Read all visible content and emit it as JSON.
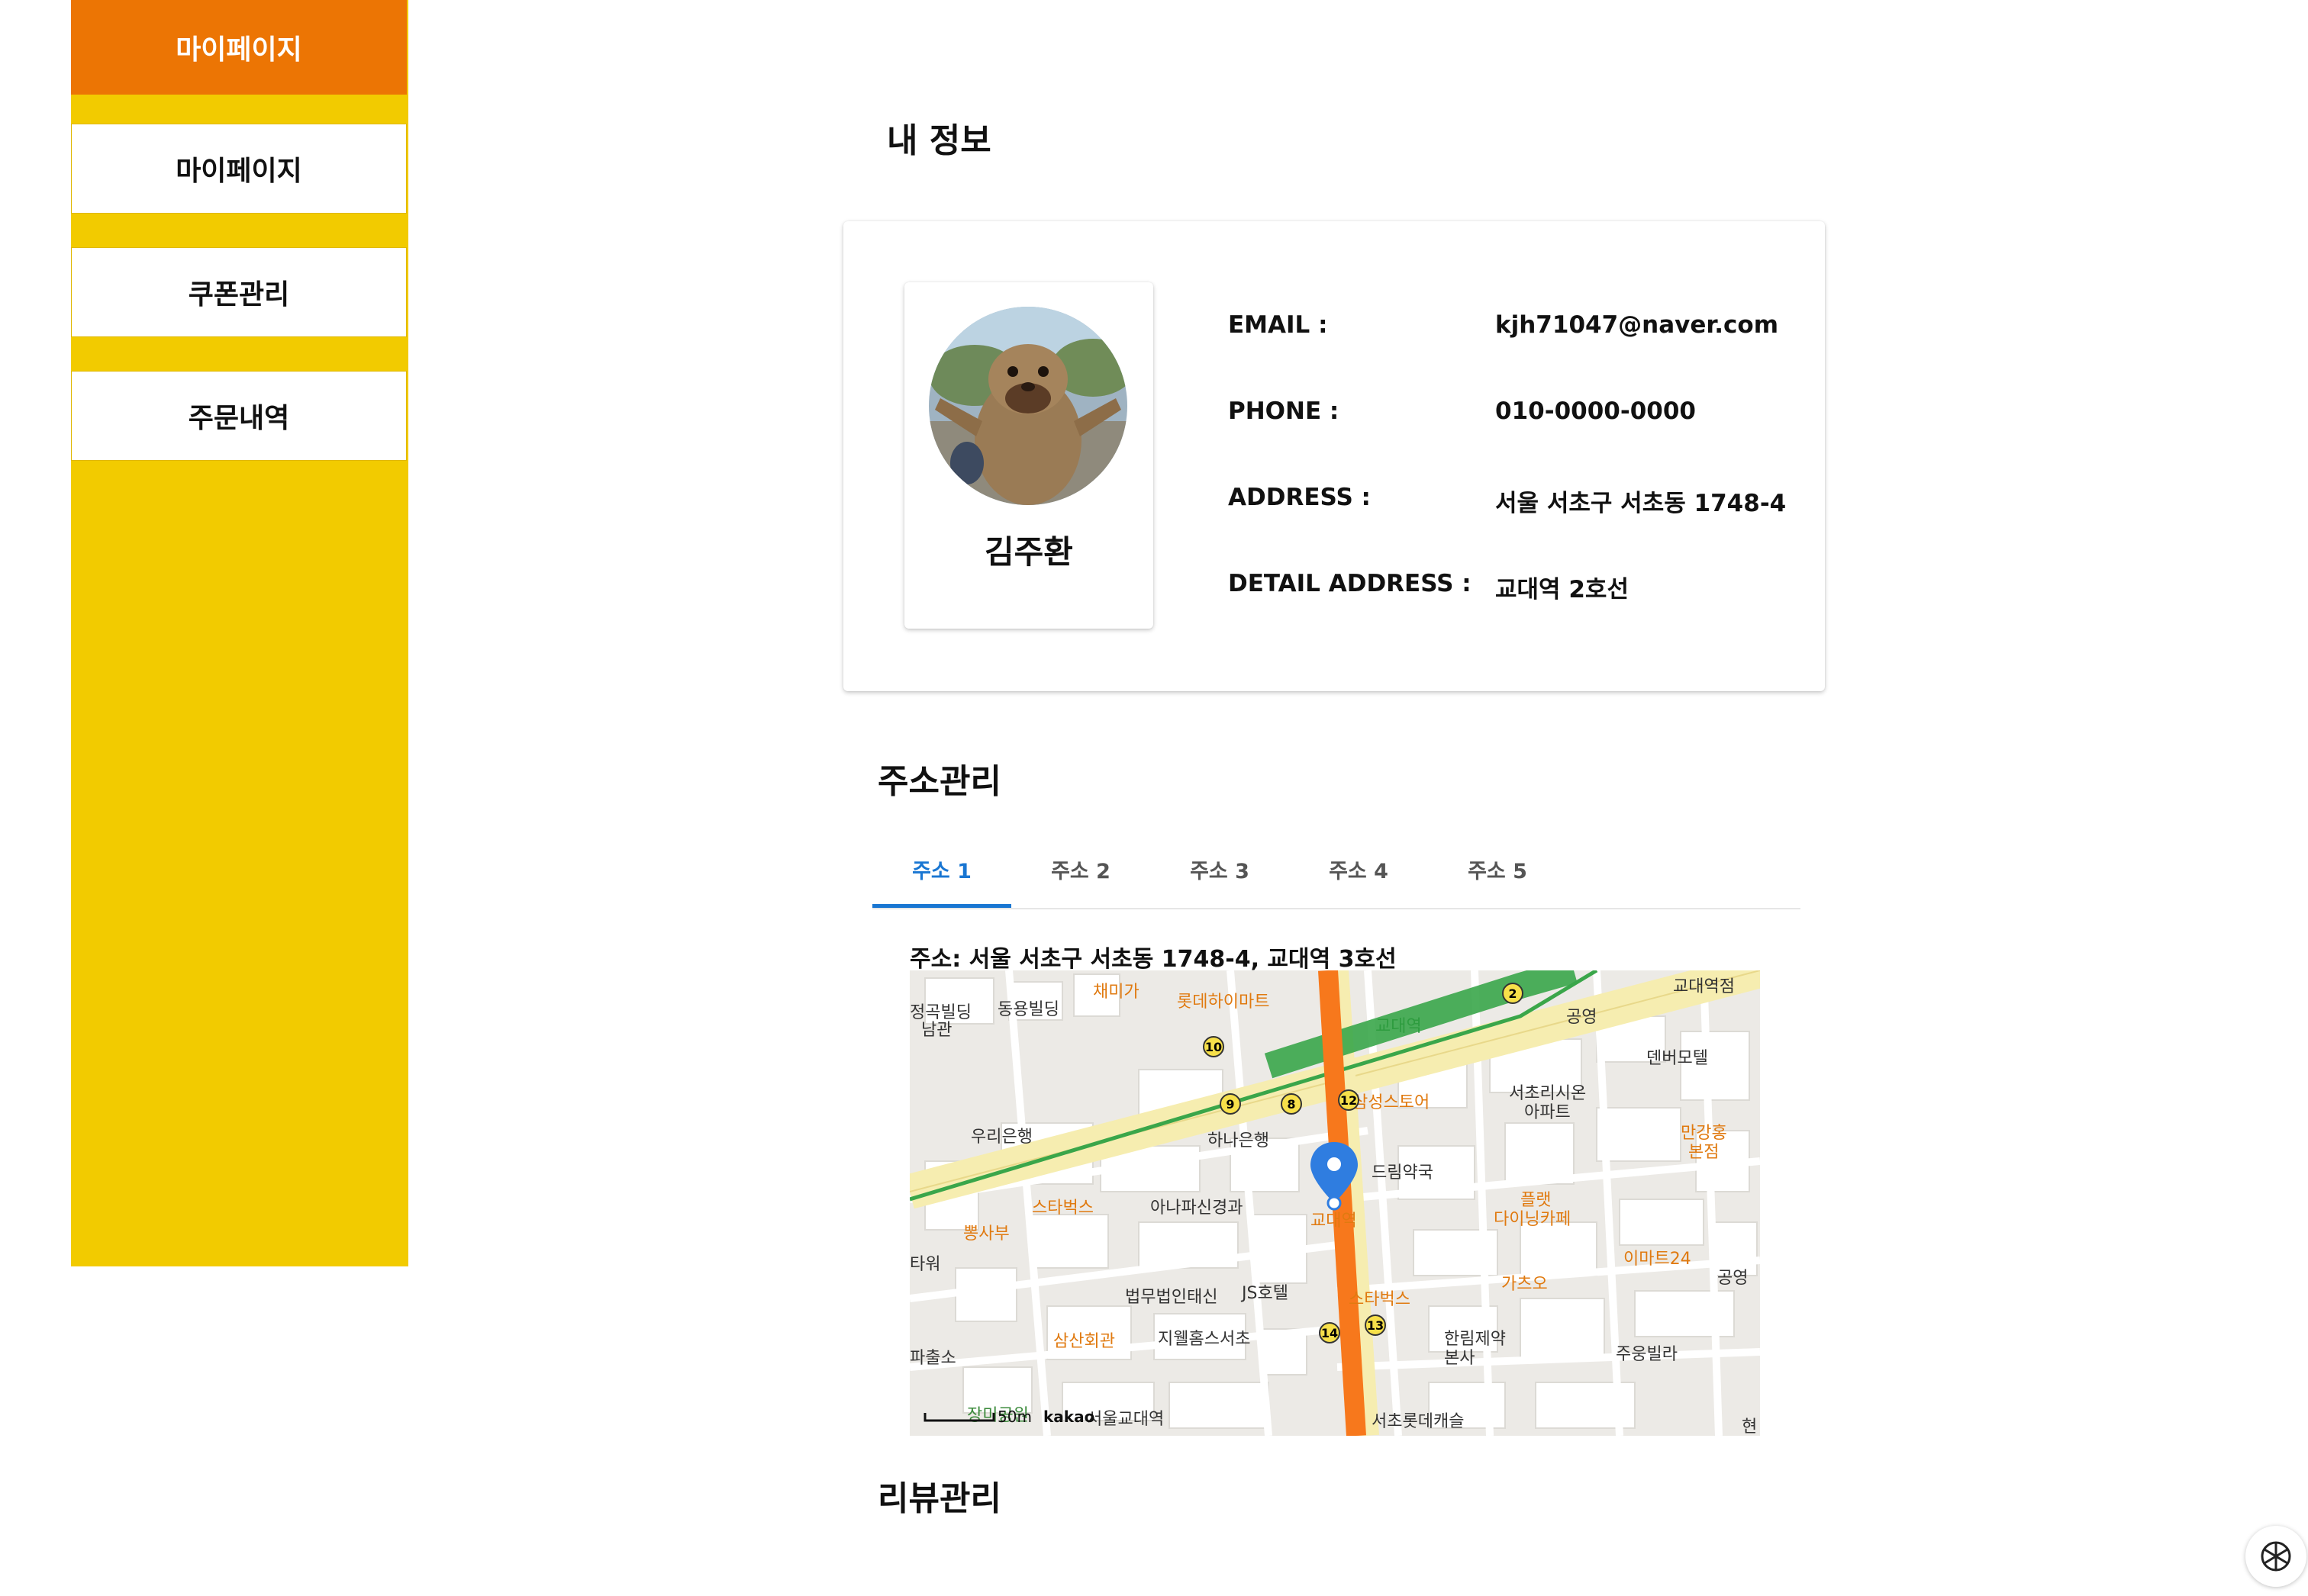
{
  "sidebar": {
    "items": [
      {
        "label": "마이페이지"
      },
      {
        "label": "마이페이지"
      },
      {
        "label": "쿠폰관리"
      },
      {
        "label": "주문내역"
      }
    ]
  },
  "sections": {
    "my_info": "내 정보",
    "address_mgmt": "주소관리",
    "review_mgmt": "리뷰관리"
  },
  "profile": {
    "name": "김주환",
    "rows": [
      {
        "label": "EMAIL :",
        "value": "kjh71047@naver.com"
      },
      {
        "label": "PHONE :",
        "value": "010-0000-0000"
      },
      {
        "label": "ADDRESS :",
        "value": "서울 서초구 서초동 1748-4"
      },
      {
        "label": "DETAIL ADDRESS :",
        "value": "교대역 2호선"
      }
    ]
  },
  "address_tabs": {
    "tabs": [
      "주소 1",
      "주소 2",
      "주소 3",
      "주소 4",
      "주소 5"
    ],
    "active_index": 0,
    "address_line": "주소: 서울 서초구 서초동 1748-4, 교대역 3호선"
  },
  "map": {
    "scale": "50m",
    "provider": "kakao",
    "labels": {
      "chaemiga": "채미가",
      "lotte_hi": "롯데하이마트",
      "dongyong": "동용빌딩",
      "left_top": "정곡빌딩",
      "left_top2": "남관",
      "kb_edu": "교대역점",
      "gyodae_top": "교대역",
      "gongyeong": "공영",
      "denver": "덴버모텔",
      "woori": "우리은행",
      "hana": "하나은행",
      "samsung": "삼성스토어",
      "seocho_sion": "서초리시온",
      "apart": "아파트",
      "mangang": "만강홍",
      "bonjeom": "본점",
      "drug": "드림약국",
      "starbucks1": "스타벅스",
      "ppongsabu": "뽕사부",
      "anapa": "아나파신경과",
      "gyodae_main": "교대역",
      "flat": "플랫",
      "dining": "다이닝카페",
      "emart": "이마트24",
      "gongyeong2": "공영",
      "tower": "타워",
      "gachoo": "가츠오",
      "law": "법무법인태신",
      "js": "JS호텔",
      "starbucks2": "스타벅스",
      "samsan": "삼산회관",
      "jiwell": "지웰홈스서초",
      "hanlim": "한림제약",
      "bonsa": "본사",
      "juung": "주웅빌라",
      "pachul": "파출소",
      "park": "장미공원",
      "gyodae_church": "서울교대역",
      "seocho_lotte": "서초롯데캐슬",
      "hyun": "현"
    }
  },
  "colors": {
    "sidebar": "#f2cb00",
    "active": "#ec7504",
    "tab_active": "#1976d2"
  }
}
